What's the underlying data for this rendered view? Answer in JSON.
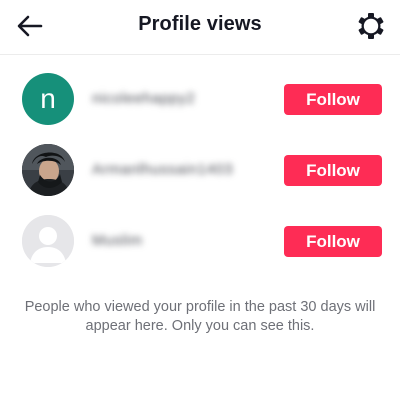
{
  "header": {
    "title": "Profile views",
    "back_icon": "arrow-left-icon",
    "settings_icon": "gear-icon"
  },
  "viewers": [
    {
      "avatar_type": "letter",
      "avatar_letter": "n",
      "avatar_color": "#16907a",
      "username": "nicoleehappy2",
      "follow_label": "Follow"
    },
    {
      "avatar_type": "photo",
      "avatar_letter": "",
      "avatar_color": "#2b2e33",
      "username": "Armanlhussain1403",
      "follow_label": "Follow"
    },
    {
      "avatar_type": "default",
      "avatar_letter": "",
      "avatar_color": "#e6e6e9",
      "username": "Muslim",
      "follow_label": "Follow"
    }
  ],
  "footer": {
    "note": "People who viewed your profile in the past 30 days will appear here. Only you can see this."
  },
  "colors": {
    "accent": "#fe2c55",
    "text_primary": "#161823",
    "text_secondary": "#6e7077"
  }
}
